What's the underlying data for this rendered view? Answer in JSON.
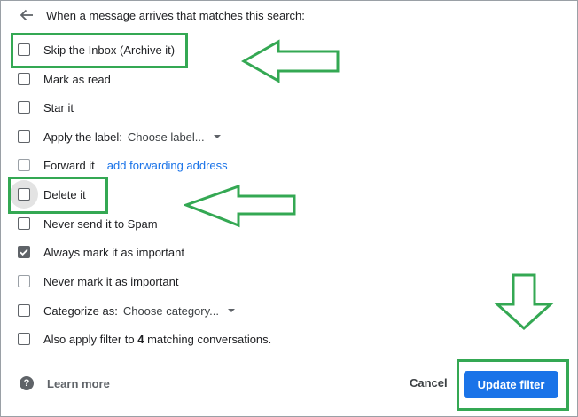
{
  "header": {
    "text": "When a message arrives that matches this search:",
    "back_icon": "arrow-back-icon"
  },
  "options": [
    {
      "label": "Skip the Inbox (Archive it)",
      "checked": false
    },
    {
      "label": "Mark as read",
      "checked": false
    },
    {
      "label": "Star it",
      "checked": false
    },
    {
      "label": "Apply the label:",
      "checked": false,
      "select_value": "Choose label..."
    },
    {
      "label": "Forward it",
      "checked": false,
      "link": "add forwarding address"
    },
    {
      "label": "Delete it",
      "checked": false
    },
    {
      "label": "Never send it to Spam",
      "checked": false
    },
    {
      "label": "Always mark it as important",
      "checked": true
    },
    {
      "label": "Never mark it as important",
      "checked": false
    },
    {
      "label": "Categorize as:",
      "checked": false,
      "select_value": "Choose category..."
    },
    {
      "label_prefix": "Also apply filter to",
      "count": "4",
      "label_suffix": "matching conversations.",
      "checked": false
    }
  ],
  "footer": {
    "help_icon": "?",
    "learn_more": "Learn more",
    "cancel": "Cancel",
    "update": "Update filter"
  },
  "colors": {
    "accent": "#1a73e8",
    "annotation": "#34a853"
  }
}
